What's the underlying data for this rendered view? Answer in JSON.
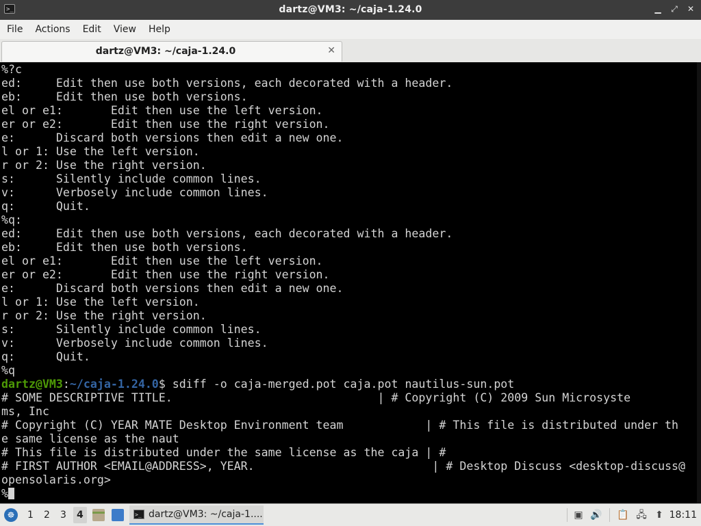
{
  "window": {
    "title": "dartz@VM3: ~/caja-1.24.0",
    "controls": {
      "minimize": "▁",
      "maximize": "⤢",
      "close": "✕"
    }
  },
  "menu": {
    "items": [
      "File",
      "Actions",
      "Edit",
      "View",
      "Help"
    ]
  },
  "tab": {
    "label": "dartz@VM3: ~/caja-1.24.0",
    "close": "✕"
  },
  "terminal": {
    "lines_before_prompt": [
      "%?c",
      "ed:     Edit then use both versions, each decorated with a header.",
      "eb:     Edit then use both versions.",
      "el or e1:       Edit then use the left version.",
      "er or e2:       Edit then use the right version.",
      "e:      Discard both versions then edit a new one.",
      "l or 1: Use the left version.",
      "r or 2: Use the right version.",
      "s:      Silently include common lines.",
      "v:      Verbosely include common lines.",
      "q:      Quit.",
      "%q:",
      "ed:     Edit then use both versions, each decorated with a header.",
      "eb:     Edit then use both versions.",
      "el or e1:       Edit then use the left version.",
      "er or e2:       Edit then use the right version.",
      "e:      Discard both versions then edit a new one.",
      "l or 1: Use the left version.",
      "r or 2: Use the right version.",
      "s:      Silently include common lines.",
      "v:      Verbosely include common lines.",
      "q:      Quit.",
      "%q"
    ],
    "prompt_user": "dartz@VM3",
    "prompt_sep": ":",
    "prompt_path": "~/caja-1.24.0",
    "prompt_cmd": "$ sdiff -o caja-merged.pot caja.pot nautilus-sun.pot",
    "lines_after_prompt": [
      "# SOME DESCRIPTIVE TITLE.                              | # Copyright (C) 2009 Sun Microsyste",
      "ms, Inc",
      "# Copyright (C) YEAR MATE Desktop Environment team            | # This file is distributed under th",
      "e same license as the naut",
      "# This file is distributed under the same license as the caja | #",
      "# FIRST AUTHOR <EMAIL@ADDRESS>, YEAR.                          | # Desktop Discuss <desktop-discuss@",
      "opensolaris.org>"
    ],
    "last_prompt": "%"
  },
  "taskbar": {
    "start_icon": "☸",
    "workspaces": [
      "1",
      "2",
      "3",
      "4"
    ],
    "active_workspace": "4",
    "task_label": "dartz@VM3: ~/caja-1....",
    "tray_icons": [
      "screenshot-icon",
      "volume-icon",
      "clipboard-icon",
      "network-icon",
      "update-icon"
    ],
    "clock": "18:11"
  }
}
